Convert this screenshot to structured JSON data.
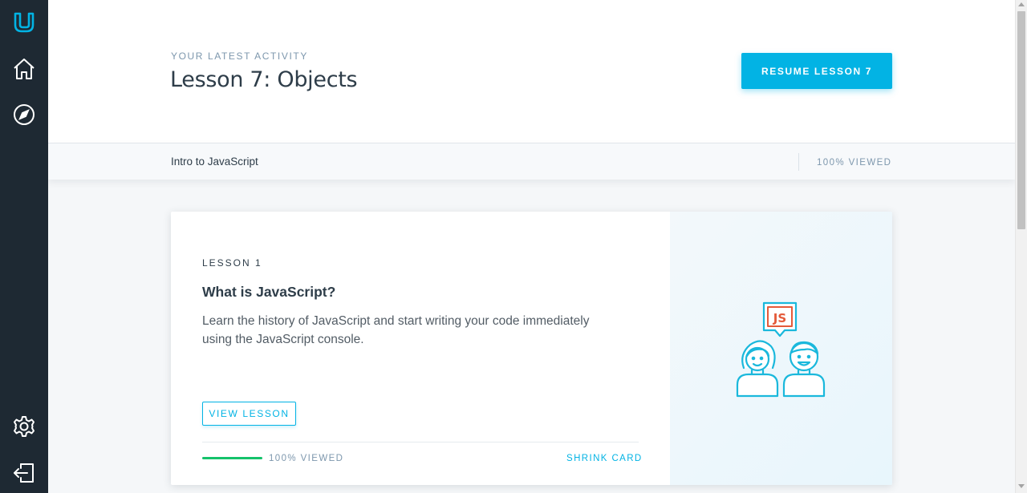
{
  "sidebar": {
    "items": [
      {
        "name": "udacity-logo-icon"
      },
      {
        "name": "home-icon"
      },
      {
        "name": "explore-compass-icon"
      },
      {
        "name": "settings-gear-icon"
      },
      {
        "name": "logout-icon"
      }
    ],
    "accent_color": "#02b3e4",
    "background_color": "#1e2933"
  },
  "header": {
    "eyebrow": "YOUR LATEST ACTIVITY",
    "title": "Lesson 7: Objects",
    "resume_label": "RESUME LESSON 7"
  },
  "course_bar": {
    "course_name": "Intro to JavaScript",
    "viewed": "100% VIEWED"
  },
  "lesson_card": {
    "number_label": "LESSON 1",
    "title": "What is JavaScript?",
    "description": "Learn the history of JavaScript and start writing your code immediately using the JavaScript console.",
    "view_label": "VIEW LESSON",
    "progress_fraction": 1.0,
    "progress_label": "100% VIEWED",
    "shrink_label": "SHRINK CARD",
    "illustration_badge": "JS",
    "illustration_icon": "two-people-js-chat-icon",
    "progress_color": "#15c26b"
  }
}
